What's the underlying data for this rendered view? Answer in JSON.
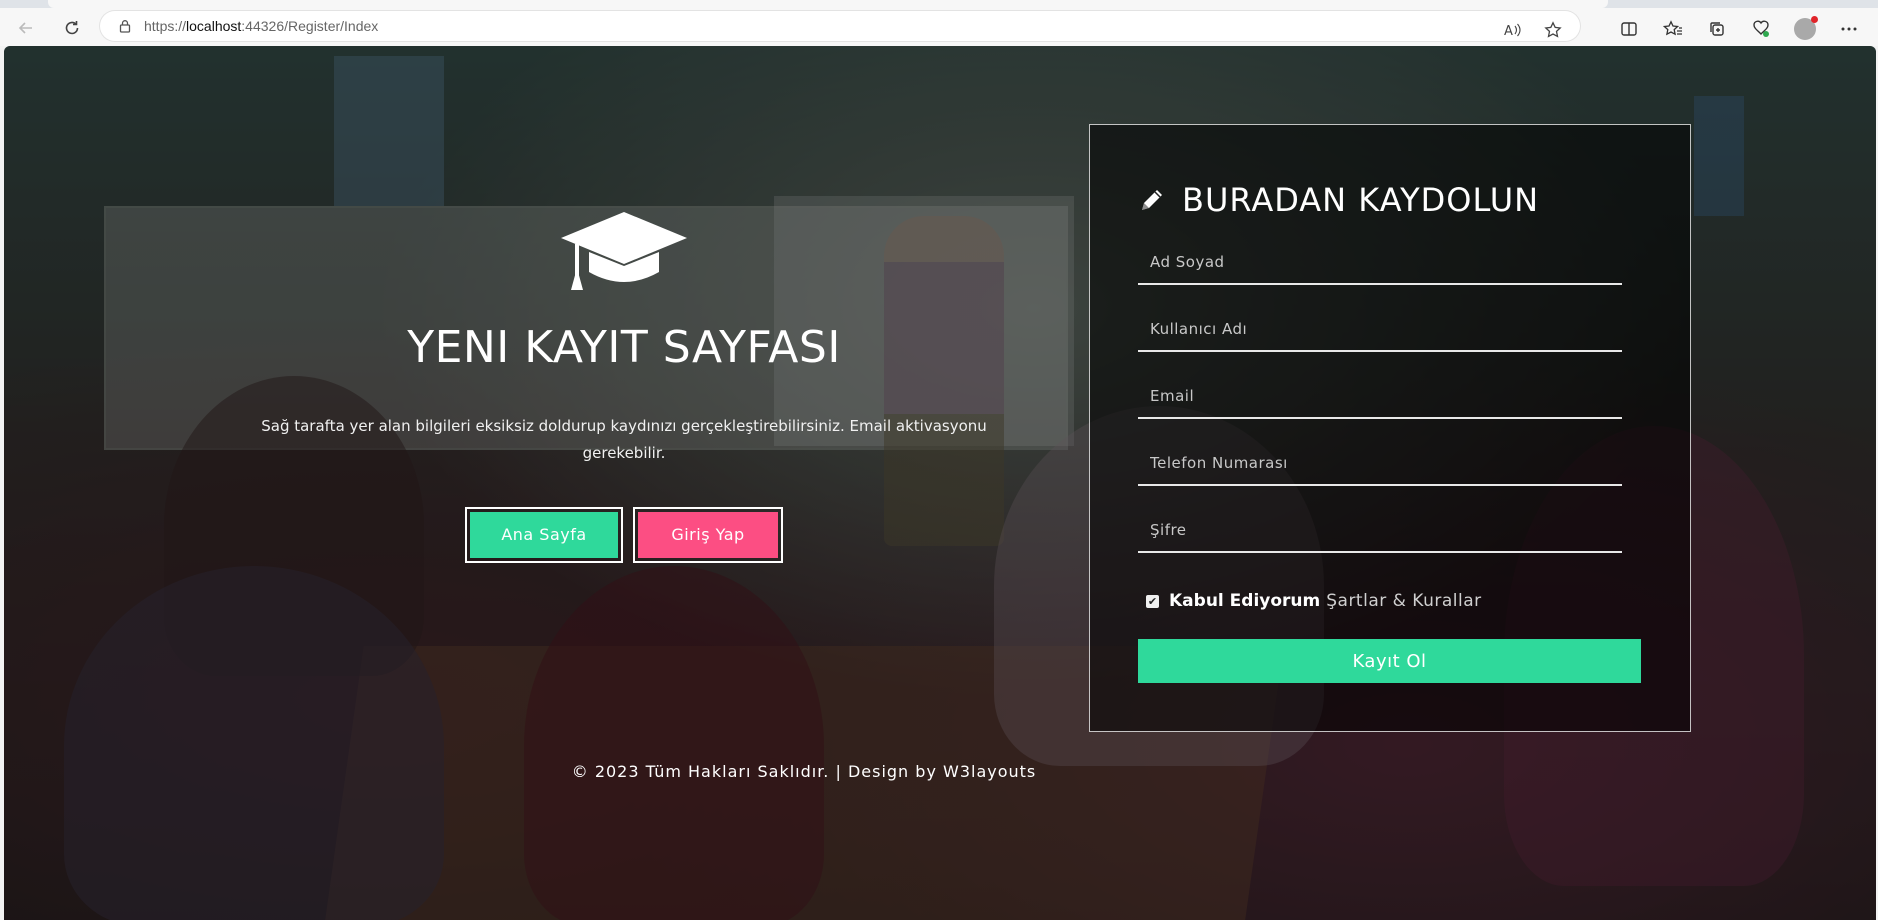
{
  "browser": {
    "url_prefix": "https://",
    "url_host": "localhost",
    "url_rest": ":44326/Register/Index"
  },
  "hero": {
    "title": "YENI KAYIT SAYFASI",
    "description": "Sağ tarafta yer alan bilgileri eksiksiz doldurup kaydınızı gerçekleştirebilirsiniz. Email aktivasyonu gerekebilir.",
    "home_button": "Ana Sayfa",
    "login_button": "Giriş Yap"
  },
  "footer": {
    "text": "© 2023 Tüm Hakları Saklıdır. | Design by W3layouts"
  },
  "form": {
    "title": "BURADAN KAYDOLUN",
    "fields": [
      {
        "placeholder": "Ad Soyad"
      },
      {
        "placeholder": "Kullanıcı Adı"
      },
      {
        "placeholder": "Email"
      },
      {
        "placeholder": "Telefon Numarası"
      },
      {
        "placeholder": "Şifre"
      }
    ],
    "accept_label": "Kabul Ediyorum",
    "terms_label": "Şartlar & Kurallar",
    "terms_checked": true,
    "submit_label": "Kayıt Ol"
  },
  "colors": {
    "accent_green": "#2fd99b",
    "accent_pink": "#fc4e83"
  },
  "icons": [
    "back-arrow-icon",
    "refresh-icon",
    "lock-icon",
    "read-aloud-icon",
    "favorite-star-icon",
    "split-screen-icon",
    "favorites-icon",
    "collections-icon",
    "extensions-icon",
    "profile-avatar",
    "more-icon",
    "graduation-cap-icon",
    "pencil-icon",
    "checkbox-check-icon"
  ]
}
